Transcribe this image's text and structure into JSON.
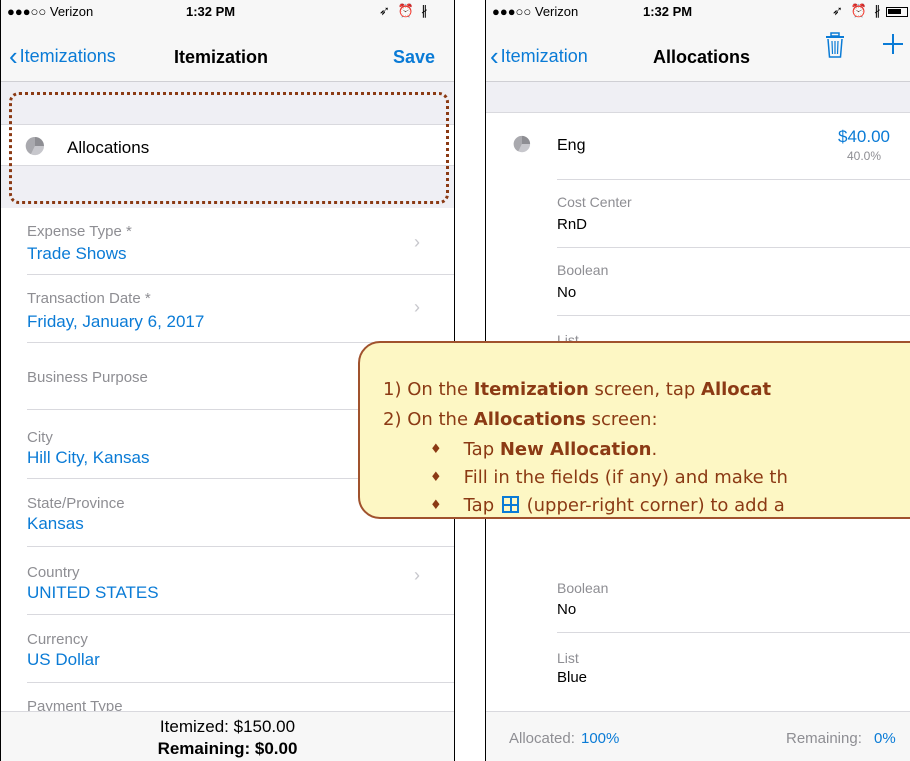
{
  "left": {
    "status": {
      "carrier": "●●●○○ Verizon",
      "time": "1:32 PM",
      "icons": "➶ ⏰ ∦"
    },
    "nav": {
      "back": "Itemizations",
      "title": "Itemization",
      "action": "Save"
    },
    "allocations_label": "Allocations",
    "fields": [
      {
        "label": "Expense Type *",
        "value": "Trade Shows"
      },
      {
        "label": "Transaction Date *",
        "value": "Friday, January 6, 2017"
      },
      {
        "label": "Business Purpose",
        "value": ""
      },
      {
        "label": "City",
        "value": "Hill City, Kansas"
      },
      {
        "label": "State/Province",
        "value": "Kansas"
      },
      {
        "label": "Country",
        "value": "UNITED STATES"
      },
      {
        "label": "Currency",
        "value": "US Dollar"
      },
      {
        "label": "Payment Type",
        "value": ""
      }
    ],
    "footer": {
      "itemized": "Itemized: $150.00",
      "remaining": "Remaining: $0.00"
    }
  },
  "right": {
    "status": {
      "carrier": "●●●○○ Verizon",
      "time": "1:32 PM",
      "icons": "➶ ⏰ ∦"
    },
    "nav": {
      "back": "Itemization",
      "title": "Allocations"
    },
    "allocation": {
      "name": "Eng",
      "amount": "$40.00",
      "percent": "40.0%"
    },
    "fields": [
      {
        "label": "Cost Center",
        "value": "RnD"
      },
      {
        "label": "Boolean",
        "value": "No"
      },
      {
        "label": "List",
        "value": ""
      }
    ],
    "fields2": [
      {
        "label": "Boolean",
        "value": "No"
      },
      {
        "label": "List",
        "value": "Blue"
      }
    ],
    "footer": {
      "allocated_label": "Allocated:",
      "allocated_value": "100%",
      "remaining_label": "Remaining:",
      "remaining_value": "0%"
    }
  },
  "callout": {
    "l1_prefix": "1) On the ",
    "l1_bold1": "Itemization",
    "l1_mid": " screen, tap ",
    "l1_bold2": "Allocat",
    "l2_prefix": "2) On the ",
    "l2_bold": "Allocations",
    "l2_suffix": " screen:",
    "b1_prefix": "Tap ",
    "b1_bold": "New Allocation",
    "b1_suffix": ".",
    "b2": "Fill in the fields (if any) and make th",
    "b3_prefix": "Tap ",
    "b3_suffix": " (upper-right corner) to add a",
    "bullet": "♦"
  },
  "colors": {
    "accent": "#0a7bd6",
    "callout_border": "#a0522d",
    "callout_bg": "#fdf7c4",
    "highlight": "#8b3a14"
  }
}
